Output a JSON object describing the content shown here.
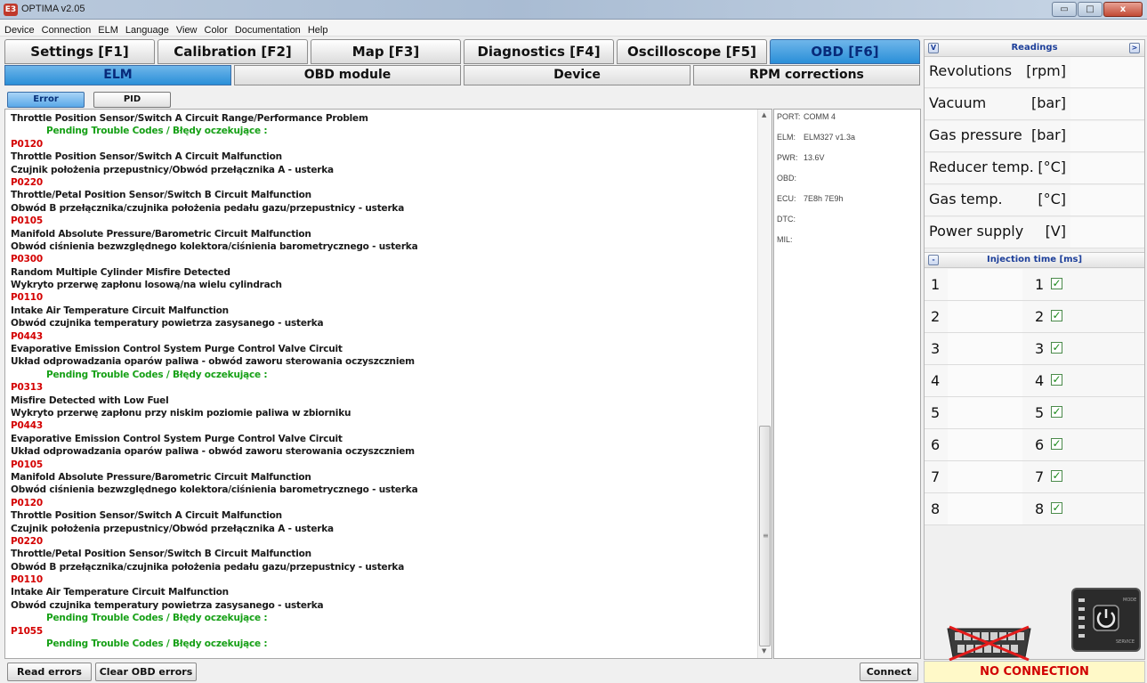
{
  "window": {
    "title": "OPTIMA v2.05",
    "logo": "E3",
    "min_glyph": "▭",
    "max_glyph": "□",
    "close_glyph": "x"
  },
  "menu": [
    "Device",
    "Connection",
    "ELM",
    "Language",
    "View",
    "Color",
    "Documentation",
    "Help"
  ],
  "main_tabs": [
    {
      "label": "Settings [F1]",
      "active": false
    },
    {
      "label": "Calibration [F2]",
      "active": false
    },
    {
      "label": "Map [F3]",
      "active": false
    },
    {
      "label": "Diagnostics [F4]",
      "active": false
    },
    {
      "label": "Oscilloscope [F5]",
      "active": false
    },
    {
      "label": "OBD [F6]",
      "active": true
    }
  ],
  "sub_tabs": [
    {
      "label": "ELM",
      "active": true
    },
    {
      "label": "OBD module",
      "active": false
    },
    {
      "label": "Device",
      "active": false
    },
    {
      "label": "RPM corrections",
      "active": false
    }
  ],
  "view_tabs": {
    "error": "Error",
    "pid": "PID"
  },
  "error_log": [
    {
      "t": "text",
      "s": "Throttle Position Sensor/Switch A Circuit Range/Performance Problem"
    },
    {
      "t": "pend",
      "s": "Pending Trouble Codes  /  Błędy oczekujące :"
    },
    {
      "t": "code",
      "s": "P0120"
    },
    {
      "t": "text",
      "s": "Throttle Position Sensor/Switch A Circuit Malfunction"
    },
    {
      "t": "text",
      "s": "Czujnik położenia przepustnicy/Obwód przełącznika A - usterka"
    },
    {
      "t": "code",
      "s": "P0220"
    },
    {
      "t": "text",
      "s": "Throttle/Petal Position Sensor/Switch B Circuit Malfunction"
    },
    {
      "t": "text",
      "s": "Obwód B przełącznika/czujnika położenia pedału gazu/przepustnicy - usterka"
    },
    {
      "t": "code",
      "s": "P0105"
    },
    {
      "t": "text",
      "s": "Manifold Absolute Pressure/Barometric Circuit Malfunction"
    },
    {
      "t": "text",
      "s": "Obwód ciśnienia bezwzględnego kolektora/ciśnienia barometrycznego - usterka"
    },
    {
      "t": "code",
      "s": "P0300"
    },
    {
      "t": "text",
      "s": "Random Multiple Cylinder Misfire Detected"
    },
    {
      "t": "text",
      "s": "Wykryto przerwę zapłonu losową/na wielu cylindrach"
    },
    {
      "t": "code",
      "s": "P0110"
    },
    {
      "t": "text",
      "s": "Intake Air Temperature Circuit Malfunction"
    },
    {
      "t": "text",
      "s": "Obwód czujnika temperatury powietrza zasysanego - usterka"
    },
    {
      "t": "code",
      "s": "P0443"
    },
    {
      "t": "text",
      "s": "Evaporative Emission Control System Purge Control Valve Circuit"
    },
    {
      "t": "text",
      "s": "Układ odprowadzania oparów paliwa - obwód zaworu sterowania oczyszczniem"
    },
    {
      "t": "pend",
      "s": "Pending Trouble Codes  /  Błędy oczekujące :"
    },
    {
      "t": "code",
      "s": "P0313"
    },
    {
      "t": "text",
      "s": "Misfire Detected with Low Fuel"
    },
    {
      "t": "text",
      "s": "Wykryto przerwę zapłonu przy niskim poziomie paliwa w zbiorniku"
    },
    {
      "t": "code",
      "s": "P0443"
    },
    {
      "t": "text",
      "s": "Evaporative Emission Control System Purge Control Valve Circuit"
    },
    {
      "t": "text",
      "s": "Układ odprowadzania oparów paliwa - obwód zaworu sterowania oczyszczniem"
    },
    {
      "t": "code",
      "s": "P0105"
    },
    {
      "t": "text",
      "s": "Manifold Absolute Pressure/Barometric Circuit Malfunction"
    },
    {
      "t": "text",
      "s": "Obwód ciśnienia bezwzględnego kolektora/ciśnienia barometrycznego - usterka"
    },
    {
      "t": "code",
      "s": "P0120"
    },
    {
      "t": "text",
      "s": "Throttle Position Sensor/Switch A Circuit Malfunction"
    },
    {
      "t": "text",
      "s": "Czujnik położenia przepustnicy/Obwód przełącznika A - usterka"
    },
    {
      "t": "code",
      "s": "P0220"
    },
    {
      "t": "text",
      "s": "Throttle/Petal Position Sensor/Switch B Circuit Malfunction"
    },
    {
      "t": "text",
      "s": "Obwód B przełącznika/czujnika położenia pedału gazu/przepustnicy - usterka"
    },
    {
      "t": "code",
      "s": "P0110"
    },
    {
      "t": "text",
      "s": "Intake Air Temperature Circuit Malfunction"
    },
    {
      "t": "text",
      "s": "Obwód czujnika temperatury powietrza zasysanego - usterka"
    },
    {
      "t": "pend",
      "s": "Pending Trouble Codes  /  Błędy oczekujące :"
    },
    {
      "t": "code",
      "s": "P1055"
    },
    {
      "t": "pend",
      "s": "Pending Trouble Codes  /  Błędy oczekujące :"
    }
  ],
  "info": [
    {
      "key": "PORT:",
      "value": "COMM 4"
    },
    {
      "key": "ELM:",
      "value": "ELM327 v1.3a"
    },
    {
      "key": "PWR:",
      "value": "13.6V"
    },
    {
      "key": "OBD:",
      "value": ""
    },
    {
      "key": "ECU:",
      "value": "7E8h 7E9h"
    },
    {
      "key": "DTC:",
      "value": ""
    },
    {
      "key": "MIL:",
      "value": ""
    }
  ],
  "readings": {
    "title": "Readings",
    "collapse_glyph": "V",
    "expand_glyph": ">",
    "rows": [
      {
        "name": "Revolutions",
        "unit": "[rpm]"
      },
      {
        "name": "Vacuum",
        "unit": "[bar]"
      },
      {
        "name": "Gas pressure",
        "unit": "[bar]"
      },
      {
        "name": "Reducer temp.",
        "unit": "[°C]"
      },
      {
        "name": "Gas temp.",
        "unit": "[°C]"
      },
      {
        "name": "Power supply",
        "unit": "[V]"
      }
    ]
  },
  "injection": {
    "title": "Injection time [ms]",
    "collapse_glyph": "-",
    "rows": [
      {
        "num": "1",
        "num2": "1",
        "checked": true
      },
      {
        "num": "2",
        "num2": "2",
        "checked": true
      },
      {
        "num": "3",
        "num2": "3",
        "checked": true
      },
      {
        "num": "4",
        "num2": "4",
        "checked": true
      },
      {
        "num": "5",
        "num2": "5",
        "checked": true
      },
      {
        "num": "6",
        "num2": "6",
        "checked": true
      },
      {
        "num": "7",
        "num2": "7",
        "checked": true
      },
      {
        "num": "8",
        "num2": "8",
        "checked": true
      }
    ]
  },
  "device_icon": {
    "mode_label": "MODE",
    "service_label": "SERVICE"
  },
  "buttons": {
    "read": "Read errors",
    "clear": "Clear OBD errors",
    "connect": "Connect"
  },
  "status": "NO CONNECTION",
  "colors": {
    "accent": "#2a8fd8",
    "code": "#d40000",
    "pending": "#16a016",
    "status": "#d10000"
  }
}
